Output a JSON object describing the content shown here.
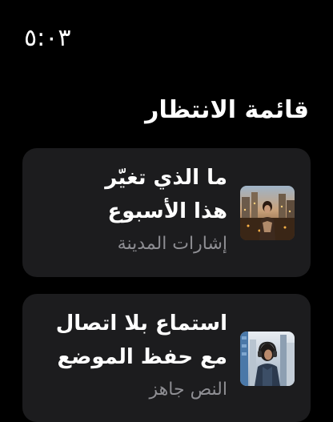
{
  "status": {
    "time": "٥:٠٣"
  },
  "queue": {
    "title": "قائمة الانتظار",
    "items": [
      {
        "title_line1": "ما الذي تغيّر",
        "title_line2": "هذا الأسبوع",
        "subtitle": "إشارات المدينة",
        "thumb_icon": "city-night-thumbnail"
      },
      {
        "title_line1": "استماع بلا اتصال",
        "title_line2": "مع حفظ الموضع",
        "subtitle": "النص جاهز",
        "thumb_icon": "city-headphones-thumbnail"
      }
    ]
  }
}
